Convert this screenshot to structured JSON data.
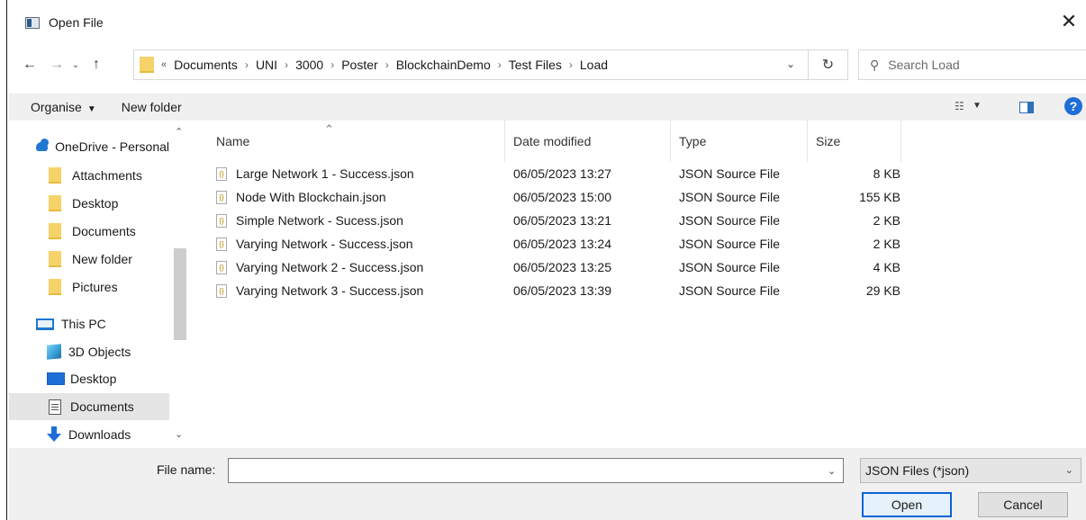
{
  "window": {
    "title": "Open File",
    "close_glyph": "✕"
  },
  "nav": {
    "back_glyph": "←",
    "forward_glyph": "→",
    "recent_glyph": "⌄",
    "up_glyph": "↑",
    "overflow": "«",
    "breadcrumbs": [
      "Documents",
      "UNI",
      "3000",
      "Poster",
      "BlockchainDemo",
      "Test Files",
      "Load"
    ],
    "refresh_glyph": "↻",
    "search_placeholder": "Search Load"
  },
  "toolbar": {
    "organise_label": "Organise",
    "new_folder_label": "New folder",
    "help_glyph": "?"
  },
  "sidebar": {
    "items": [
      {
        "label": "OneDrive - Personal",
        "icon": "cloud-icon"
      },
      {
        "label": "Attachments",
        "icon": "folder-icon"
      },
      {
        "label": "Desktop",
        "icon": "folder-icon"
      },
      {
        "label": "Documents",
        "icon": "folder-icon"
      },
      {
        "label": "New folder",
        "icon": "folder-icon"
      },
      {
        "label": "Pictures",
        "icon": "folder-icon"
      },
      {
        "label": "This PC",
        "icon": "computer-icon"
      },
      {
        "label": "3D Objects",
        "icon": "cube-icon"
      },
      {
        "label": "Desktop",
        "icon": "desktop-icon"
      },
      {
        "label": "Documents",
        "icon": "document-icon",
        "selected": true
      },
      {
        "label": "Downloads",
        "icon": "download-icon"
      }
    ]
  },
  "columns": {
    "name": "Name",
    "date": "Date modified",
    "type": "Type",
    "size": "Size"
  },
  "files": [
    {
      "name": "Large Network 1 - Success.json",
      "date": "06/05/2023 13:27",
      "type": "JSON Source File",
      "size": "8 KB"
    },
    {
      "name": "Node With Blockchain.json",
      "date": "06/05/2023 15:00",
      "type": "JSON Source File",
      "size": "155 KB"
    },
    {
      "name": "Simple Network - Sucess.json",
      "date": "06/05/2023 13:21",
      "type": "JSON Source File",
      "size": "2 KB"
    },
    {
      "name": "Varying Network - Success.json",
      "date": "06/05/2023 13:24",
      "type": "JSON Source File",
      "size": "2 KB"
    },
    {
      "name": "Varying Network 2 - Success.json",
      "date": "06/05/2023 13:25",
      "type": "JSON Source File",
      "size": "4 KB"
    },
    {
      "name": "Varying Network 3 - Success.json",
      "date": "06/05/2023 13:39",
      "type": "JSON Source File",
      "size": "29 KB"
    }
  ],
  "footer": {
    "file_name_label": "File name:",
    "file_name_value": "",
    "filter_label": "JSON Files (*json)",
    "open_label": "Open",
    "cancel_label": "Cancel"
  }
}
